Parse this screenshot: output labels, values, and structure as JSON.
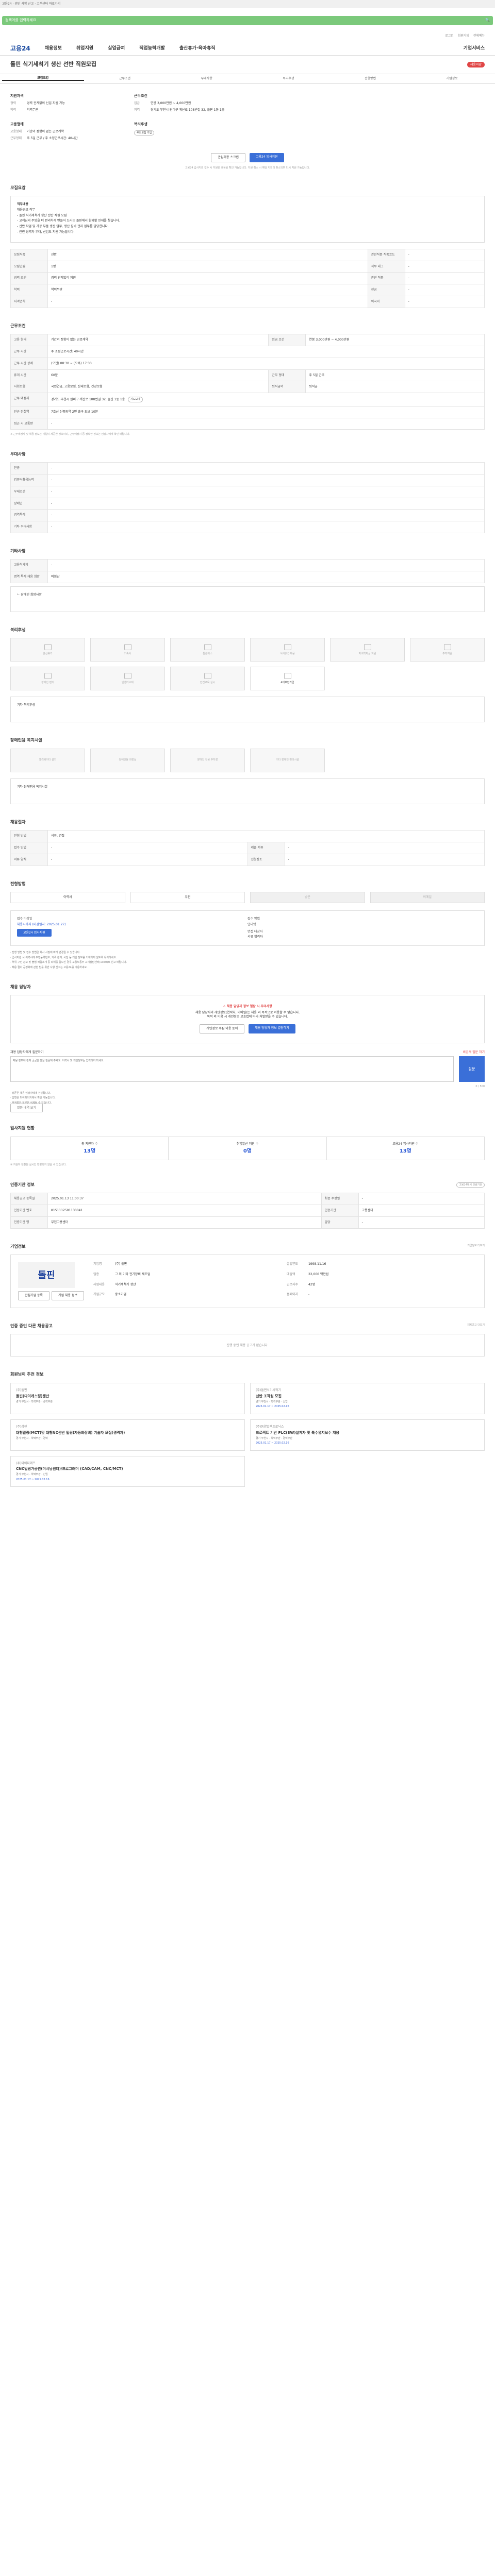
{
  "topbar": {
    "text": "고용24 · 위반 사항 신고 · 고객센터 바로가기"
  },
  "search": {
    "placeholder": "검색어를 입력하세요"
  },
  "util": [
    "로그인",
    "회원가입",
    "전체메뉴"
  ],
  "gnb": {
    "logo": "고용24",
    "items": [
      "채용정보",
      "취업지원",
      "실업급여",
      "직업능력개발",
      "출산휴가·육아휴직"
    ],
    "right": "기업서비스"
  },
  "title": {
    "text": "돌핀 식기세척기 생산 선반 직원모집",
    "badge": "채용마감"
  },
  "tabs": [
    "모집요강",
    "근무조건",
    "우대사항",
    "복리후생",
    "전형방법",
    "기업정보"
  ],
  "summary": {
    "col1_head": "지원자격",
    "col1": [
      {
        "k": "경력",
        "v": "경력 관계없이 신입 지원 가능"
      },
      {
        "k": "학력",
        "v": "학력무관"
      }
    ],
    "col2_head": "근무조건",
    "col2": [
      {
        "k": "임금",
        "v": "연봉 3,000만원 ~ 4,000만원"
      },
      {
        "k": "지역",
        "v": "경기도 부천시 원미구 계산로 108번길 32, 돌핀 1동 1층"
      }
    ],
    "col3_head": "고용형태",
    "col3": [
      {
        "k": "고용형태",
        "v": "기간의 정함이 없는 근로계약"
      },
      {
        "k": "근무형태",
        "v": "주 5일 근무 / 주 소정근로시간: 40시간"
      }
    ],
    "col4_head": "복리후생",
    "col4_tag": "4대 보험 가입"
  },
  "actions": {
    "scrap": "관심채용 스크랩",
    "apply": "고용24 입사지원",
    "notice": "고용24 입사지원 접수 시 지원한 내용을 확인 가능합니다. 지원 취소 시 해당 지원이 취소되며 다시 지원 가능합니다."
  },
  "sec_recruit": {
    "title": "모집요강",
    "box_title": "직무내용",
    "box_sub": "채용공고 직무",
    "box_lines": [
      "- 돌핀 식기세척기 생산 선반 직원 모집",
      "- 고객님의 주방을 더 편리하게 만들어 드리는 돌핀에서 함께할 인재를 찾습니다.",
      "- 선반 작업 및 가공 부품 생산 업무, 생산 설비 관리 업무를 담당합니다.",
      "- 관련 경력자 우대, 신입도 지원 가능합니다."
    ],
    "rows": [
      {
        "k": "모집직종",
        "v": "선반"
      },
      {
        "k": "관련직종 직종코드",
        "v": "-"
      },
      {
        "k": "모집인원",
        "v": "1명"
      },
      {
        "k": "직무 태그",
        "v": "-"
      },
      {
        "k": "경력 조건",
        "v": "경력 관계없이 지원"
      },
      {
        "k": "관련 직종",
        "v": "-"
      },
      {
        "k": "학력",
        "v": "학력무관"
      },
      {
        "k": "전공",
        "v": "-"
      },
      {
        "k": "자격면허",
        "v": "-"
      },
      {
        "k": "외국어",
        "v": "-"
      }
    ]
  },
  "sec_work": {
    "title": "근무조건",
    "rows": [
      {
        "k": "고용 형태",
        "v": "기간의 정함이 없는 근로계약"
      },
      {
        "k": "임금 조건",
        "v": "연봉 3,000만원 ~ 4,000만원"
      },
      {
        "k": "근무 시간",
        "v": "주 소정근로시간: 40시간"
      },
      {
        "k": "근무 시간 상세",
        "v": "(오전) 08:30 ~ (오후) 17:30"
      },
      {
        "k": "휴게 시간",
        "v": "60분"
      },
      {
        "k": "근무 형태",
        "v": "주 5일 근무"
      },
      {
        "k": "사회보험",
        "v": "국민연금, 고용보험, 산재보험, 건강보험"
      },
      {
        "k": "퇴직급여",
        "v": "퇴직금"
      },
      {
        "k": "근무 예정지",
        "v": "경기도 부천시 원미구 계산로 108번길 32, 돌핀 1동 1층"
      },
      {
        "k": "인근 전철역",
        "v": "7호선 신중동역 2번 출구 도보 10분"
      },
      {
        "k": "지도보기",
        "v": "지도보기"
      },
      {
        "k": "퇴근 시 교통편",
        "v": "-"
      }
    ],
    "note": "※ 근무예정지 및 채용 정보는 기업이 제공한 정보이며, 근무예정지 등 정확한 정보는 담당자에게 확인 바랍니다."
  },
  "sec_pref": {
    "title": "우대사항",
    "rows": [
      {
        "k": "전공",
        "v": "-"
      },
      {
        "k": "컴퓨터활용능력",
        "v": "-"
      },
      {
        "k": "우대조건",
        "v": "-"
      },
      {
        "k": "장애인",
        "v": "-"
      },
      {
        "k": "병역특례",
        "v": "-"
      },
      {
        "k": "기타 우대사항",
        "v": "-"
      }
    ]
  },
  "sec_etc": {
    "title": "기타사항",
    "rows": [
      {
        "k": "고용허가제",
        "v": "-"
      },
      {
        "k": "병역 특례 채용 희망",
        "v": "미희망"
      }
    ],
    "box": "ㄴ 장애인 희망사항"
  },
  "sec_welfare": {
    "title": "복리후생",
    "items": [
      "출산휴가",
      "기숙사",
      "통근버스",
      "식사(비) 제공",
      "자녀학자금 지원",
      "주택지원",
      "장애인 편의",
      "인센티브제",
      "안전교육 실시",
      "4대보험가입"
    ],
    "box": "기타 복리후생"
  },
  "sec_disab": {
    "title": "장애인용 복지시설",
    "items": [
      "엘리베이터 설치",
      "장애인용 화장실",
      "장애인 전용 주차장",
      "기타 장애인 편의시설"
    ],
    "box": "기타 장애인용 복지시설"
  },
  "sec_select": {
    "title": "채용절차",
    "rows": [
      {
        "k": "전형 방법",
        "v": "서류, 면접"
      },
      {
        "k": "접수 방법",
        "v": "-"
      },
      {
        "k": "제출 서류",
        "v": "-"
      },
      {
        "k": "서류 양식",
        "v": "-"
      },
      {
        "k": "전형장소",
        "v": "-"
      }
    ]
  },
  "sec_apply": {
    "title": "전형방법",
    "methods": [
      "이력서",
      "우편",
      "방문",
      "이메일"
    ],
    "period_lbl1": "접수 마감일",
    "period_val1": "채용시까지 (마감일자: 2025.01.27)",
    "period_lbl2": "접수 방법",
    "period_val2": "인터넷",
    "period_lbl3": "면접 대상자",
    "period_val3": "서류 합격자",
    "apply_btn": "고용24 입사지원",
    "bullets": [
      "· 전형 방법 및 접수 방법은 회사 사정에 따라 변경될 수 있습니다.",
      "· 입사지원 시 이력서에 주민등록번호, 가족 관계, 사진 등 개인 정보를 기재하지 않도록 유의하세요.",
      "· 허위 구인 광고 및 불법 직업소개 등 피해를 입으신 경우 고용노동부 고객상담센터(1350)로 신고 바랍니다.",
      "· 채용 절차 공정화에 관한 법률 위반 사항 신고는 고용24를 이용하세요."
    ]
  },
  "sec_contact": {
    "title": "채용 담당자",
    "warn": "채용 담당자 정보 열람 시 주의사항",
    "desc1": "채용 담당자의 개인정보(연락처, 이메일)는 채용 외 목적으로 이용할 수 없습니다.",
    "desc2": "목적 외 이용 시 개인정보 보호법에 따라 처벌받을 수 있습니다.",
    "btn1": "개인정보 수집·이용 동의",
    "btn2": "채용 담당자 정보 열람하기",
    "inq_label": "채용 담당자에게 질문하기",
    "inq_right": "비공개 질문 하기",
    "inq_placeholder": "채용 정보에 관해 궁금한 점을 질문해 주세요. 이력서 및 개인정보는 입력하지 마세요.",
    "inq_count": "0 / 500",
    "inq_btn": "질문",
    "notes": [
      "· 질문은 채용 담당자에게 전달됩니다.",
      "· 답변은 마이페이지에서 확인 가능합니다.",
      "· 부적절한 질문은 삭제될 수 있습니다."
    ],
    "notes_btn": "질문 내역 보기"
  },
  "sec_status": {
    "title": "입사지원 현황",
    "cols": [
      {
        "lbl": "총 지원자 수",
        "n": "13명"
      },
      {
        "lbl": "취업알선 지원 수",
        "n": "0명"
      },
      {
        "lbl": "고용24 입사지원 수",
        "n": "13명"
      }
    ],
    "note": "※ 지원자 현황은 실시간 반영되지 않을 수 있습니다."
  },
  "sec_info": {
    "title": "인증기관 정보",
    "right": "고용24에서 인증기관",
    "rows": [
      {
        "k": "채용공고 등록일",
        "v": "2025.01.13 11:00:37"
      },
      {
        "k": "최종 수정일",
        "v": "-"
      },
      {
        "k": "인증기관 번호",
        "v": "K151112501130041"
      },
      {
        "k": "인증기관",
        "v": "고용센터"
      },
      {
        "k": "인증기관 명",
        "v": "부천고용센터"
      },
      {
        "k": "담당",
        "v": "-"
      }
    ]
  },
  "sec_company": {
    "title": "기업정보",
    "right": "기업정보 더보기",
    "logo": "돌핀",
    "info": [
      {
        "k": "기업명",
        "v": "(주) 돌핀"
      },
      {
        "k": "설립연도",
        "v": "1998.11.16"
      },
      {
        "k": "업종",
        "v": "그 외 기타 전기장비 제조업"
      },
      {
        "k": "매출액",
        "v": "22,000 백만원"
      },
      {
        "k": "사업내용",
        "v": "식기세척기 생산"
      },
      {
        "k": "근로자수",
        "v": "42명"
      },
      {
        "k": "기업규모",
        "v": "중소기업"
      },
      {
        "k": "홈페이지",
        "v": "-"
      }
    ],
    "btn1": "관심기업 등록",
    "btn2": "기업 채용 정보"
  },
  "sec_same": {
    "title": "인증 중인 다른 채용공고",
    "right": "채용공고 더보기",
    "empty": "진행 중인 채용 공고가 없습니다."
  },
  "sec_rec": {
    "title": "회원님이 추천 정보",
    "items": [
      {
        "co": "(주)돌핀",
        "tt": "돌핀(다이캐스팅)생산",
        "meta": "경기 부천시 · 학력무관 · 경력무관",
        "dt": ""
      },
      {
        "co": "(주)돌핀식기세척기",
        "tt": "선반 조작원 모집",
        "meta": "경기 부천시 · 학력무관 · 신입",
        "dt": "2025.01.17 ~ 2025.02.16"
      },
      {
        "co": "(주)상진",
        "tt": "대형밀링(MCT)및 대형NC선반 밀링(자동화장비) 기술자 모집(경력자)",
        "meta": "경기 부천시 · 학력무관 · 경력",
        "dt": ""
      },
      {
        "co": "(주)동양일렉트로닉스",
        "tt": "프로젝트 기반 PLC(SW)설계자 및 특수유지보수 채용",
        "meta": "경기 부천시 · 학력무관 · 경력무관",
        "dt": "2025.01.17 ~ 2025.02.16"
      },
      {
        "co": "(주)와이피에프",
        "tt": "CNC밀링가공원(머시닝센터)/프로그래머 (CAD/CAM, CNC/MCT)",
        "meta": "경기 부천시 · 학력무관 · 신입",
        "dt": "2025.01.17 ~ 2025.02.16"
      }
    ]
  }
}
